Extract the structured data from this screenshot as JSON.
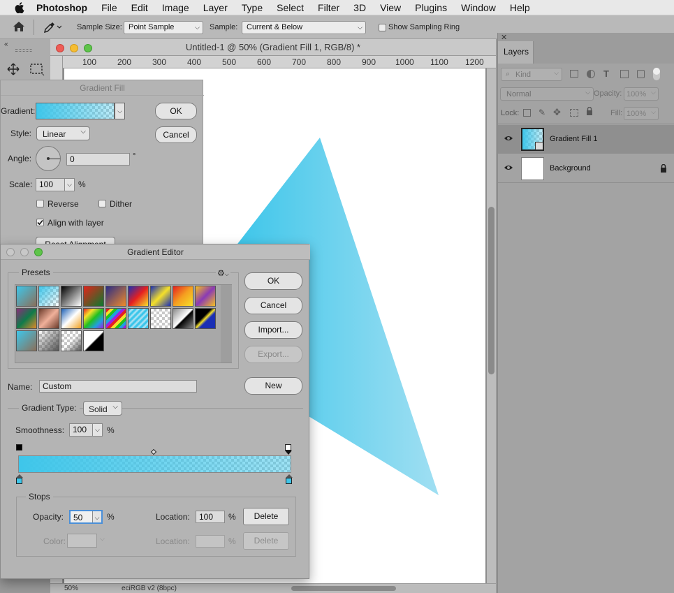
{
  "menubar": {
    "app": "Photoshop",
    "items": [
      "File",
      "Edit",
      "Image",
      "Layer",
      "Type",
      "Select",
      "Filter",
      "3D",
      "View",
      "Plugins",
      "Window",
      "Help"
    ]
  },
  "options": {
    "sample_size_label": "Sample Size:",
    "sample_size_value": "Point Sample",
    "sample_label": "Sample:",
    "sample_value": "Current & Below",
    "ring_label": "Show Sampling Ring"
  },
  "document": {
    "title": "Untitled-1 @ 50% (Gradient Fill 1, RGB/8) *",
    "ruler": [
      "100",
      "200",
      "300",
      "400",
      "500",
      "600",
      "700",
      "800",
      "900",
      "1000",
      "1100",
      "1200"
    ],
    "zoom": "50%",
    "profile": "eciRGB v2 (8bpc)"
  },
  "layers_panel": {
    "tab": "Layers",
    "kind_label": "Kind",
    "blend_mode": "Normal",
    "opacity_label": "Opacity:",
    "opacity_value": "100%",
    "lock_label": "Lock:",
    "fill_label": "Fill:",
    "fill_value": "100%",
    "layers": [
      {
        "name": "Gradient Fill 1"
      },
      {
        "name": "Background"
      }
    ]
  },
  "gradient_fill": {
    "title": "Gradient Fill",
    "gradient_label": "Gradient:",
    "style_label": "Style:",
    "style_value": "Linear",
    "angle_label": "Angle:",
    "angle_value": "0",
    "degree_symbol": "°",
    "scale_label": "Scale:",
    "scale_value": "100",
    "percent": "%",
    "reverse_label": "Reverse",
    "dither_label": "Dither",
    "align_label": "Align with layer",
    "reset_label": "Reset Alignment",
    "ok": "OK",
    "cancel": "Cancel"
  },
  "gradient_editor": {
    "title": "Gradient Editor",
    "presets_label": "Presets",
    "ok": "OK",
    "cancel": "Cancel",
    "import": "Import...",
    "export": "Export...",
    "name_label": "Name:",
    "name_value": "Custom",
    "new": "New",
    "type_label": "Gradient Type:",
    "type_value": "Solid",
    "smooth_label": "Smoothness:",
    "smooth_value": "100",
    "percent": "%",
    "stops_label": "Stops",
    "opacity_label": "Opacity:",
    "opacity_value": "50",
    "location_label": "Location:",
    "location_value": "100",
    "delete": "Delete",
    "color_label": "Color:",
    "location2_label": "Location:",
    "delete2": "Delete"
  },
  "colors": {
    "gradient_cyan": "#3ec6ea",
    "shape_light": "#a0dff2"
  }
}
